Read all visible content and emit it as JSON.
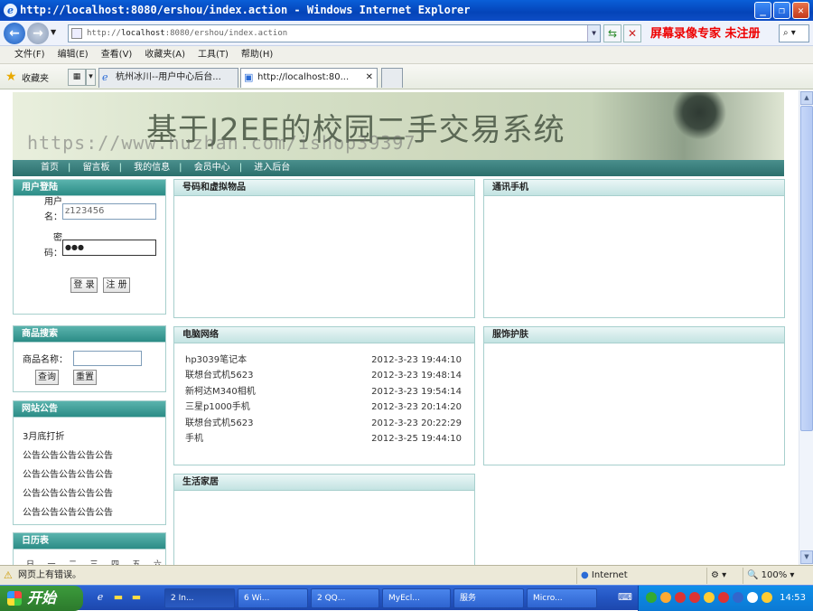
{
  "window": {
    "title": "http://localhost:8080/ershou/index.action - Windows Internet Explorer"
  },
  "address": {
    "prefix": "http://",
    "host": "localhost",
    "path": ":8080/ershou/index.action"
  },
  "recorder_text": "屏幕录像专家 未注册",
  "menu": [
    "文件(F)",
    "编辑(E)",
    "查看(V)",
    "收藏夹(A)",
    "工具(T)",
    "帮助(H)"
  ],
  "favorites": {
    "label": "收藏夹"
  },
  "tabs": [
    {
      "label": "杭州冰川--用户中心后台..."
    },
    {
      "label": "http://localhost:80..."
    }
  ],
  "site": {
    "banner_title": "基于J2EE的校园二手交易系统",
    "watermark": "https://www.huzhan.com/ishop39397",
    "nav": [
      "首页",
      "留言板",
      "我的信息",
      "会员中心",
      "进入后台"
    ],
    "nav_sep": "|"
  },
  "login": {
    "header": "用户登陆",
    "user_label_1": "用户",
    "user_label_2": "名：",
    "username": "z123456",
    "pwd_label_1": "密",
    "pwd_label_2": "码：",
    "password_mask": "●●●",
    "login_btn": "登 录",
    "register_btn": "注 册"
  },
  "search": {
    "header": "商品搜索",
    "name_label": "商品名称：",
    "query_btn": "查询",
    "reset_btn": "重置"
  },
  "notice": {
    "header": "网站公告",
    "items": [
      "3月底打折",
      "公告公告公告公告公告",
      "公告公告公告公告公告",
      "公告公告公告公告公告",
      "公告公告公告公告公告"
    ]
  },
  "calendar": {
    "header": "日历表",
    "weekdays": [
      "日",
      "一",
      "二",
      "三",
      "四",
      "五",
      "六"
    ]
  },
  "categories": {
    "virtual": {
      "header": "号码和虚拟物品"
    },
    "phone": {
      "header": "通讯手机"
    },
    "computer": {
      "header": "电脑网络",
      "products": [
        {
          "name": "hp3039笔记本",
          "date": "2012-3-23 19:44:10"
        },
        {
          "name": "联想台式机5623",
          "date": "2012-3-23 19:48:14"
        },
        {
          "name": "新柯达M340相机",
          "date": "2012-3-23 19:54:14"
        },
        {
          "name": "三星p1000手机",
          "date": "2012-3-23 20:14:20"
        },
        {
          "name": "联想台式机5623",
          "date": "2012-3-23 20:22:29"
        },
        {
          "name": "手机",
          "date": "2012-3-25 19:44:10"
        }
      ]
    },
    "clothing": {
      "header": "服饰护肤"
    },
    "home": {
      "header": "生活家居"
    }
  },
  "status": {
    "message": "网页上有错误。",
    "zone": "Internet",
    "zoom": "100%"
  },
  "taskbar": {
    "start": "开始",
    "tasks": [
      "2 In...",
      "6 Wi...",
      "2 QQ...",
      "MyEcl...",
      "服务",
      "Micro..."
    ],
    "clock": "14:53"
  }
}
